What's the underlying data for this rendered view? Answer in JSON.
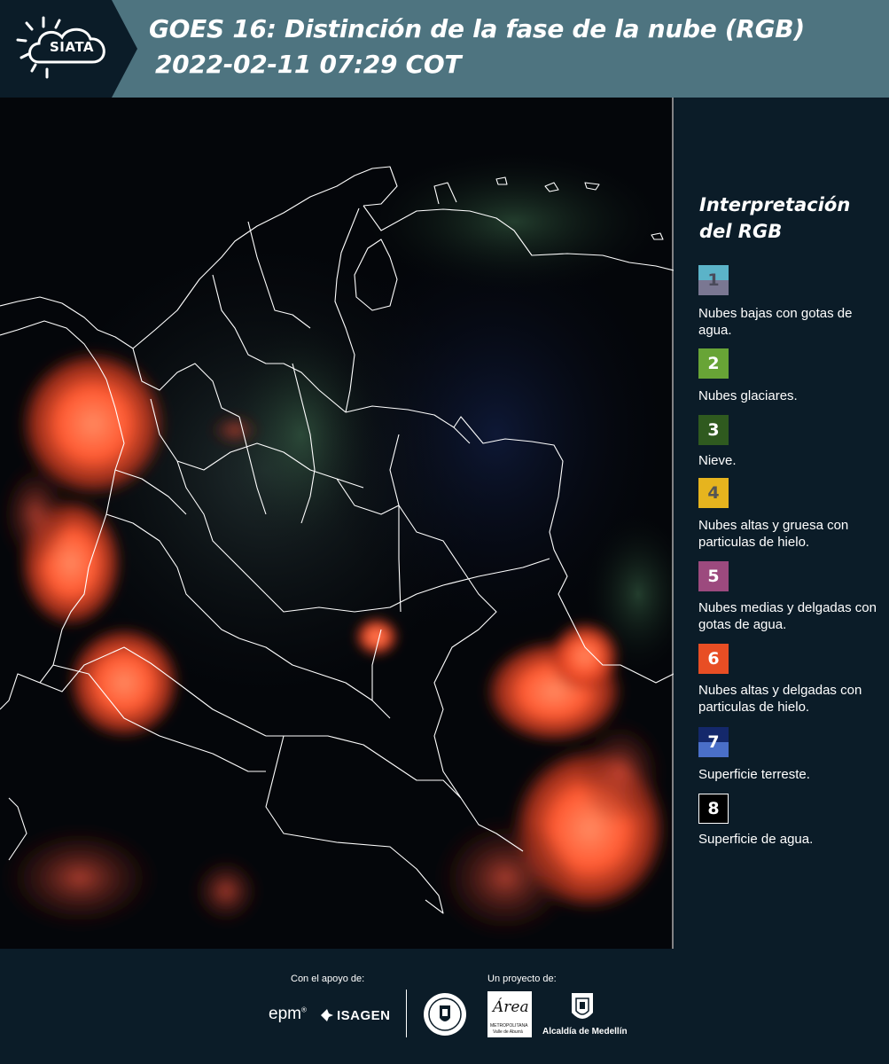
{
  "header": {
    "brand": "SIATA",
    "title_line1": "GOES 16: Distinción de la fase de la nube (RGB)",
    "title_line2": "2022-02-11 07:29 COT",
    "colors": {
      "bar": "#4e7480",
      "logo_block": "#0b1c28"
    }
  },
  "map": {
    "description_icon": "goes16-rgb-satellite-map",
    "colors": {
      "background": "#04060a",
      "border_lines": "#ffffff",
      "hot_clouds": "#ff5a32"
    }
  },
  "legend": {
    "title": "Interpretación del RGB",
    "items": [
      {
        "number": "1",
        "label": "Nubes bajas con gotas de agua.",
        "top_color": "#5bb3c8",
        "bottom_color": "#7a7792",
        "number_color": "#4a4a5a"
      },
      {
        "number": "2",
        "label": "Nubes glaciares.",
        "color": "#68a436",
        "number_color": "#ffffff"
      },
      {
        "number": "3",
        "label": "Nieve.",
        "color": "#2f5a1f",
        "number_color": "#ffffff"
      },
      {
        "number": "4",
        "label": "Nubes altas y gruesa con particulas de hielo.",
        "color": "#e6b41e",
        "number_color": "#555555"
      },
      {
        "number": "5",
        "label": "Nubes medias y delgadas con gotas de agua.",
        "color": "#9c4a7e",
        "number_color": "#ffffff"
      },
      {
        "number": "6",
        "label": "Nubes altas y delgadas con particulas de hielo.",
        "color": "#e84e24",
        "number_color": "#ffffff"
      },
      {
        "number": "7",
        "label": "Superficie terreste.",
        "top_color": "#14286b",
        "bottom_color": "#4a6fc8",
        "number_color": "#ffffff"
      },
      {
        "number": "8",
        "label": "Superficie de agua.",
        "color": "#000000",
        "border": "#ffffff",
        "number_color": "#ffffff"
      }
    ]
  },
  "footer": {
    "support_caption": "Con el apoyo de:",
    "project_caption": "Un proyecto de:",
    "epm": "epm",
    "epm_mark": "®",
    "isagen": "ISAGEN",
    "area_word": "Área",
    "area_sub1": "METROPOLITANA",
    "area_sub2": "Valle de Aburrá",
    "alcaldia": "Alcaldía de Medellín"
  }
}
